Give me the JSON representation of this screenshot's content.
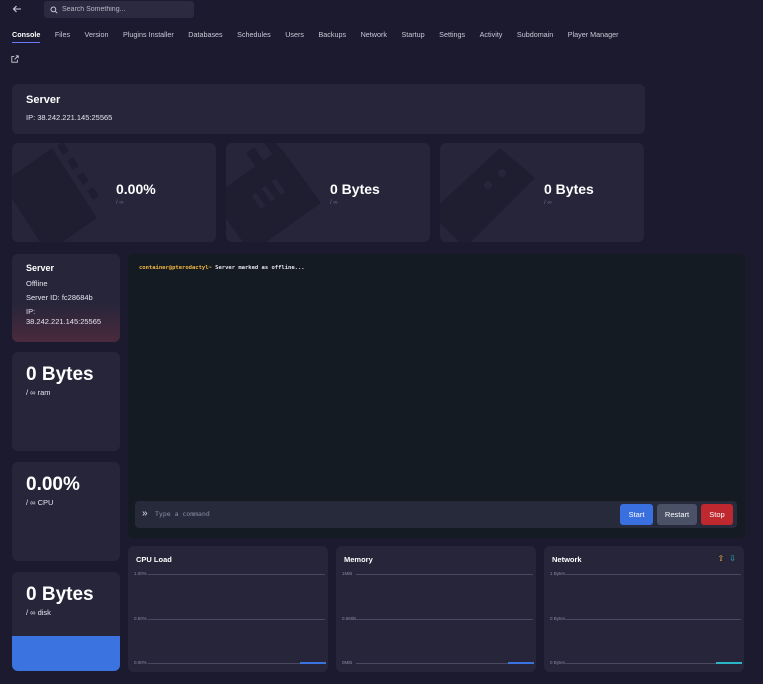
{
  "nav": {
    "back_icon": "arrow-left-icon",
    "search_placeholder": "Search Something...",
    "search_icon": "search-icon"
  },
  "tabs": [
    {
      "label": "Console",
      "active": true
    },
    {
      "label": "Files"
    },
    {
      "label": "Version"
    },
    {
      "label": "Plugins Installer"
    },
    {
      "label": "Databases"
    },
    {
      "label": "Schedules"
    },
    {
      "label": "Users"
    },
    {
      "label": "Backups"
    },
    {
      "label": "Network"
    },
    {
      "label": "Startup"
    },
    {
      "label": "Settings"
    },
    {
      "label": "Activity"
    },
    {
      "label": "Subdomain"
    },
    {
      "label": "Player Manager"
    }
  ],
  "server": {
    "title": "Server",
    "ip": "IP: 38.242.221.145:25565"
  },
  "stats": [
    {
      "value": "0.00%",
      "limit": "/ ∞",
      "icon": "cpu-chip-icon"
    },
    {
      "value": "0 Bytes",
      "limit": "/ ∞",
      "icon": "memory-stick-icon"
    },
    {
      "value": "0 Bytes",
      "limit": "/ ∞",
      "icon": "hard-drive-icon"
    }
  ],
  "status": {
    "title": "Server",
    "state": "Offline",
    "server_id": "Server ID: fc28684b",
    "ip_label": "IP:",
    "ip": "38.242.221.145:25565",
    "tint": "#4a2a3d"
  },
  "side": {
    "ram": {
      "value": "0 Bytes",
      "sub": "/ ∞ ram"
    },
    "cpu": {
      "value": "0.00%",
      "sub": "/ ∞ CPU"
    },
    "disk": {
      "value": "0 Bytes",
      "sub": "/ ∞ disk",
      "fill_color": "#3b73e0"
    }
  },
  "console": {
    "prompt": "container@pterodactyl~",
    "message": " Server marked as offline...",
    "input_placeholder": "Type a command",
    "chevron": "»",
    "start_label": "Start",
    "restart_label": "Restart",
    "stop_label": "Stop"
  },
  "graphs": [
    {
      "title": "CPU Load",
      "ticks": [
        "1.00%",
        "0.50%",
        "0.00%"
      ],
      "line_color": "#3b73e0"
    },
    {
      "title": "Memory",
      "ticks": [
        "1MiB",
        "0.5MiB",
        "0MiB"
      ],
      "line_color": "#3b73e0"
    },
    {
      "title": "Network",
      "ticks": [
        "1 Bytes",
        "0 Bytes",
        "0 Bytes"
      ],
      "line_color": "#2bb6c8",
      "icons": [
        "upload-icon",
        "download-icon"
      ]
    }
  ],
  "colors": {
    "background": "#1b1a2e",
    "card": "#26253a",
    "accent": "#3a6fe0",
    "danger": "#c0282f",
    "prompt": "#f5b840"
  }
}
